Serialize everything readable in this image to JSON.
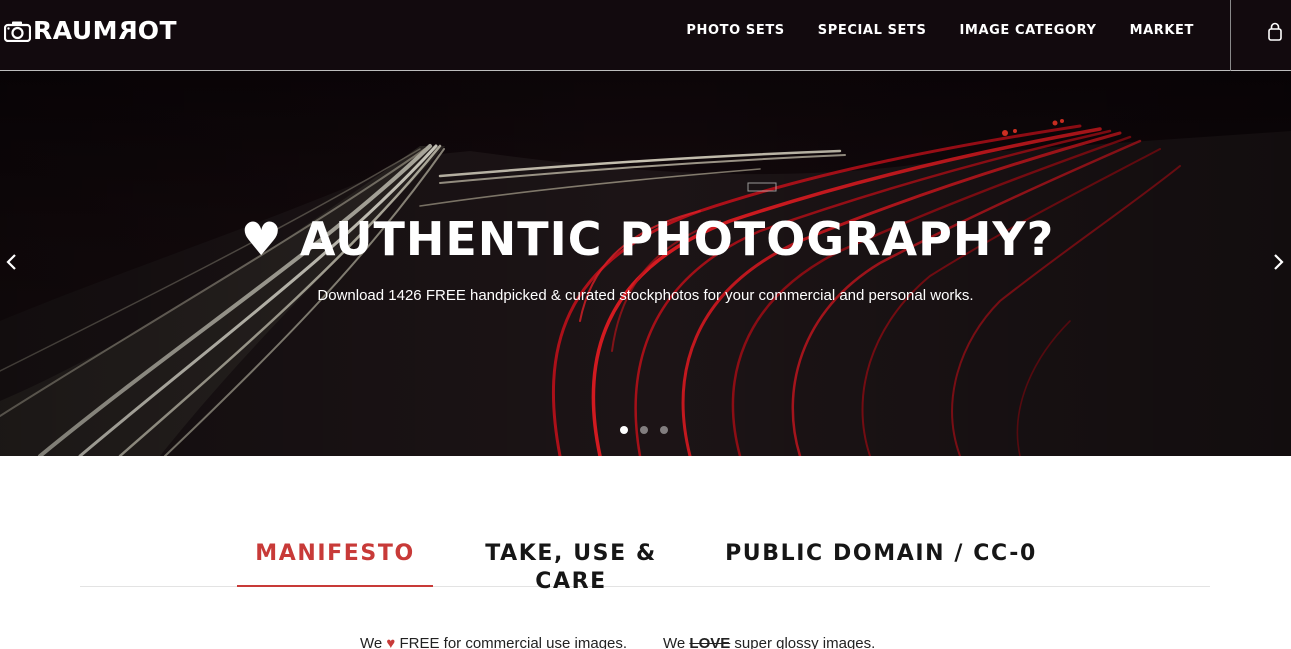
{
  "header": {
    "logo_text": "RAUM",
    "logo_flipped": "R",
    "logo_tail": "OT",
    "nav": [
      "PHOTO SETS",
      "SPECIAL SETS",
      "IMAGE CATEGORY",
      "MARKET"
    ],
    "cart_icon": "shopping-bag-icon"
  },
  "hero": {
    "title": "♥ AUTHENTIC PHOTOGRAPHY?",
    "subtitle": "Download 1426 FREE handpicked & curated stockphotos for your commercial and personal works.",
    "slide_count": 3,
    "active_slide": 1,
    "prev_icon": "chevron-left-icon",
    "next_icon": "chevron-right-icon"
  },
  "tabs": {
    "items": [
      "MANIFESTO",
      "TAKE, USE & CARE",
      "PUBLIC DOMAIN / CC-0"
    ],
    "active": "MANIFESTO"
  },
  "manifesto": {
    "line1_pre": "We",
    "line1_heart": "♥",
    "line1_post": "FREE for commercial use images.",
    "line2_pre": "We",
    "line2_strike": "LOVE",
    "line2_post": "super glossy images."
  },
  "colors": {
    "header_bg": "#120a0e",
    "accent": "#c83a38",
    "text": "#161616"
  }
}
